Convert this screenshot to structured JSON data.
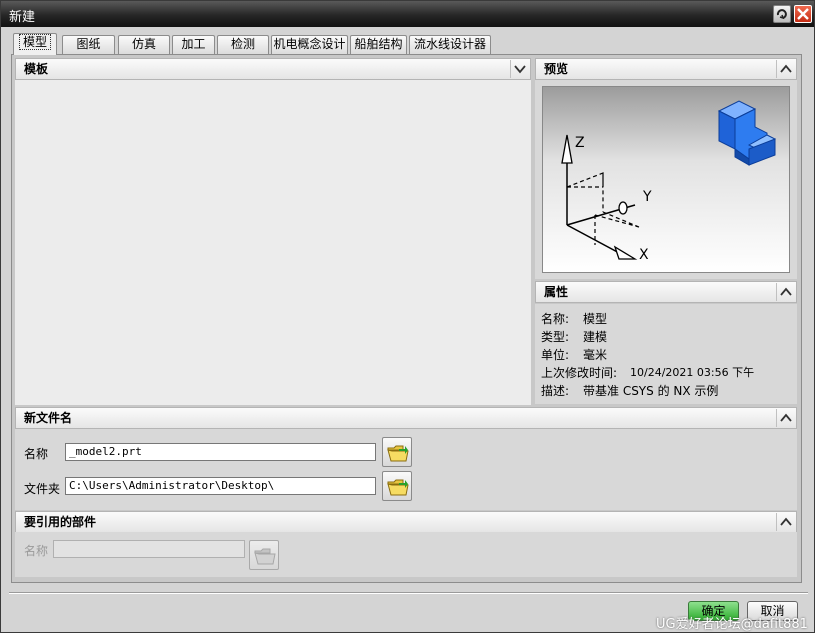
{
  "window": {
    "title": "新建"
  },
  "tabs": [
    {
      "label": "模型",
      "active": true
    },
    {
      "label": "图纸"
    },
    {
      "label": "仿真"
    },
    {
      "label": "加工"
    },
    {
      "label": "检测"
    },
    {
      "label": "机电概念设计"
    },
    {
      "label": "船舶结构"
    },
    {
      "label": "流水线设计器"
    }
  ],
  "template_section": {
    "title": "模板"
  },
  "preview_section": {
    "title": "预览",
    "axis_labels": {
      "x": "X",
      "y": "Y",
      "z": "Z"
    }
  },
  "properties_section": {
    "title": "属性",
    "rows": [
      {
        "key": "名称:",
        "value": "模型"
      },
      {
        "key": "类型:",
        "value": "建模"
      },
      {
        "key": "单位:",
        "value": "毫米"
      },
      {
        "key": "上次修改时间:",
        "value": "10/24/2021 03:56 下午"
      },
      {
        "key": "描述:",
        "value": "带基准 CSYS 的 NX 示例"
      }
    ]
  },
  "new_file_section": {
    "title": "新文件名",
    "name_label": "名称",
    "name_value": "_model2.prt",
    "folder_label": "文件夹",
    "folder_value": "C:\\Users\\Administrator\\Desktop\\"
  },
  "referenced_parts_section": {
    "title": "要引用的部件",
    "name_label": "名称",
    "name_value": ""
  },
  "buttons": {
    "ok": "确定",
    "cancel": "取消"
  },
  "watermark": "UG爱好者论坛@dafit881",
  "icons": {
    "help": "help-icon",
    "close": "close-icon",
    "collapse": "chevron-up-icon",
    "expand": "chevron-down-icon",
    "folder": "open-folder-icon",
    "part": "3d-part-icon"
  },
  "colors": {
    "titlebar": "#262626",
    "close_button": "#c52d15",
    "ok_button": "#2fae2f",
    "part_icon": "#1a5fd6"
  }
}
